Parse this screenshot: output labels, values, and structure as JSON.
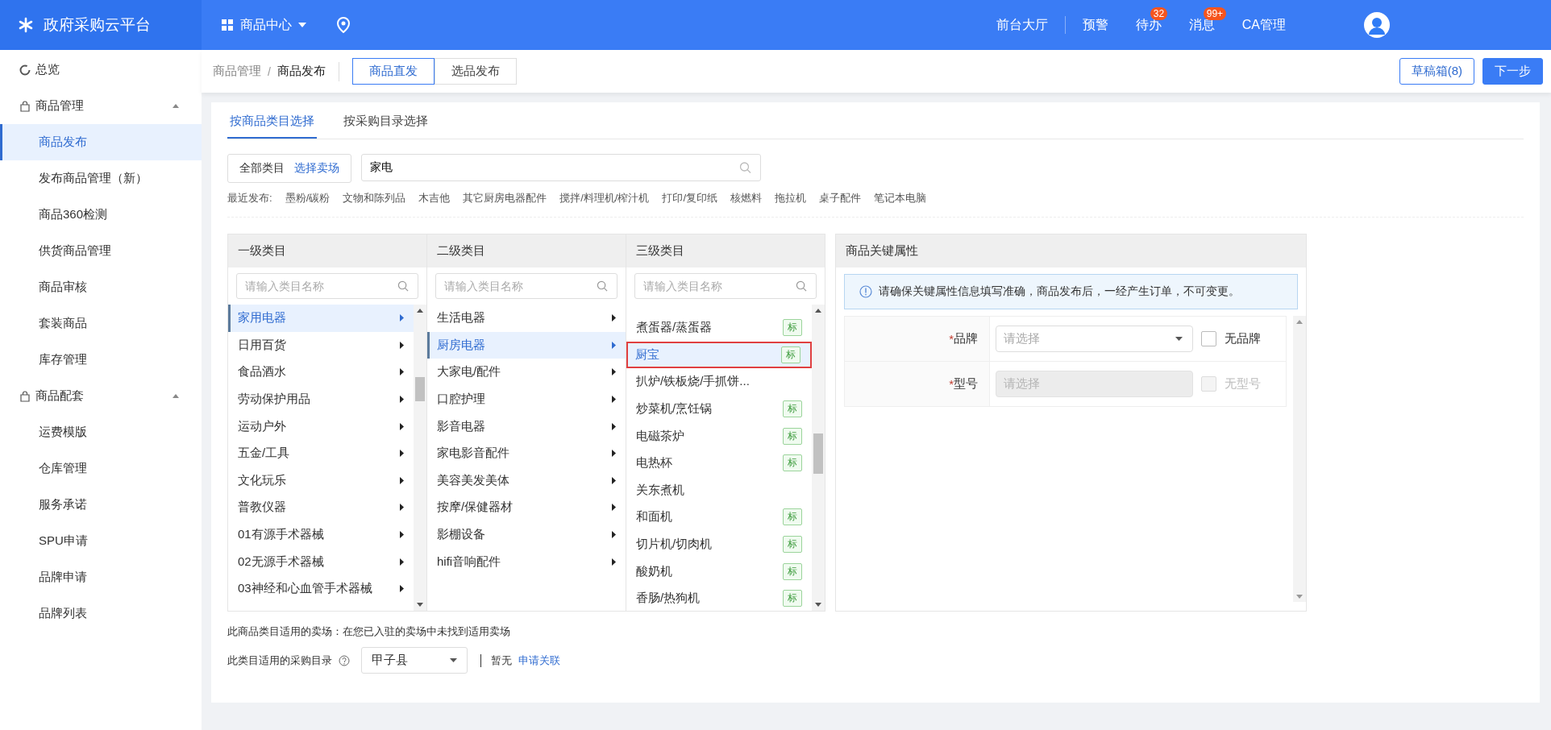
{
  "topbar": {
    "logo": "政府采购云平台",
    "nav_menu": "商品中心",
    "links": [
      {
        "label": "前台大厅"
      },
      {
        "label": "预警"
      },
      {
        "label": "待办",
        "badge": "32"
      },
      {
        "label": "消息",
        "badge": "99+"
      },
      {
        "label": "CA管理"
      }
    ]
  },
  "sidebar": {
    "items": [
      {
        "label": "总览",
        "kind": "link",
        "selected": false
      },
      {
        "label": "商品管理",
        "kind": "group",
        "expanded": true,
        "children": [
          {
            "label": "商品发布",
            "selected": true
          },
          {
            "label": "发布商品管理（新）",
            "selected": false
          },
          {
            "label": "商品360检测",
            "selected": false
          },
          {
            "label": "供货商品管理",
            "selected": false
          },
          {
            "label": "商品审核",
            "selected": false
          },
          {
            "label": "套装商品",
            "selected": false
          },
          {
            "label": "库存管理",
            "selected": false
          }
        ]
      },
      {
        "label": "商品配套",
        "kind": "group",
        "expanded": true,
        "children": [
          {
            "label": "运费模版",
            "selected": false
          },
          {
            "label": "仓库管理",
            "selected": false
          },
          {
            "label": "服务承诺",
            "selected": false
          },
          {
            "label": "SPU申请",
            "selected": false
          },
          {
            "label": "品牌申请",
            "selected": false
          },
          {
            "label": "品牌列表",
            "selected": false
          }
        ]
      }
    ]
  },
  "breadcrumb": {
    "items": [
      "商品管理",
      "商品发布"
    ],
    "separator": "/"
  },
  "mode_tabs": [
    {
      "label": "商品直发",
      "selected": true
    },
    {
      "label": "选品发布",
      "selected": false
    }
  ],
  "header_buttons": [
    {
      "label": "草稿箱(8)",
      "kind": "outline"
    },
    {
      "label": "下一步",
      "kind": "primary"
    }
  ],
  "category_tabs": [
    {
      "label": "按商品类目选择",
      "selected": true
    },
    {
      "label": "按采购目录选择",
      "selected": false
    }
  ],
  "scope": {
    "label": "全部类目",
    "link": "选择卖场"
  },
  "search": {
    "value": "家电"
  },
  "recent": {
    "label": "最近发布:",
    "items": [
      "墨粉/碳粉",
      "文物和陈列品",
      "木吉他",
      "其它厨房电器配件",
      "搅拌/料理机/榨汁机",
      "打印/复印纸",
      "核燃料",
      "拖拉机",
      "桌子配件",
      "笔记本电脑"
    ]
  },
  "columns": [
    {
      "title": "一级类目",
      "placeholder": "请输入类目名称",
      "items": [
        {
          "label": "家用电器",
          "selected": true,
          "has_children": true
        },
        {
          "label": "日用百货",
          "selected": false,
          "has_children": true
        },
        {
          "label": "食品酒水",
          "selected": false,
          "has_children": true
        },
        {
          "label": "劳动保护用品",
          "selected": false,
          "has_children": true
        },
        {
          "label": "运动户外",
          "selected": false,
          "has_children": true
        },
        {
          "label": "五金/工具",
          "selected": false,
          "has_children": true
        },
        {
          "label": "文化玩乐",
          "selected": false,
          "has_children": true
        },
        {
          "label": "普教仪器",
          "selected": false,
          "has_children": true
        },
        {
          "label": "01有源手术器械",
          "selected": false,
          "has_children": true
        },
        {
          "label": "02无源手术器械",
          "selected": false,
          "has_children": true
        },
        {
          "label": "03神经和心血管手术器械",
          "selected": false,
          "has_children": true
        }
      ]
    },
    {
      "title": "二级类目",
      "placeholder": "请输入类目名称",
      "items": [
        {
          "label": "生活电器",
          "selected": false,
          "has_children": true
        },
        {
          "label": "厨房电器",
          "selected": true,
          "has_children": true
        },
        {
          "label": "大家电/配件",
          "selected": false,
          "has_children": true
        },
        {
          "label": "口腔护理",
          "selected": false,
          "has_children": true
        },
        {
          "label": "影音电器",
          "selected": false,
          "has_children": true
        },
        {
          "label": "家电影音配件",
          "selected": false,
          "has_children": true
        },
        {
          "label": "美容美发美体",
          "selected": false,
          "has_children": true
        },
        {
          "label": "按摩/保健器材",
          "selected": false,
          "has_children": true
        },
        {
          "label": "影棚设备",
          "selected": false,
          "has_children": true
        },
        {
          "label": "hifi音响配件",
          "selected": false,
          "has_children": true
        }
      ]
    },
    {
      "title": "三级类目",
      "placeholder": "请输入类目名称",
      "items": [
        {
          "label": "煮蛋器/蒸蛋器",
          "selected": false,
          "has_children": false,
          "tag": "标"
        },
        {
          "label": "厨宝",
          "selected": true,
          "has_children": false,
          "tag": "标"
        },
        {
          "label": "扒炉/铁板烧/手抓饼...",
          "selected": false,
          "has_children": false
        },
        {
          "label": "炒菜机/烹饪锅",
          "selected": false,
          "has_children": false,
          "tag": "标"
        },
        {
          "label": "电磁茶炉",
          "selected": false,
          "has_children": false,
          "tag": "标"
        },
        {
          "label": "电热杯",
          "selected": false,
          "has_children": false,
          "tag": "标"
        },
        {
          "label": "关东煮机",
          "selected": false,
          "has_children": false
        },
        {
          "label": "和面机",
          "selected": false,
          "has_children": false,
          "tag": "标"
        },
        {
          "label": "切片机/切肉机",
          "selected": false,
          "has_children": false,
          "tag": "标"
        },
        {
          "label": "酸奶机",
          "selected": false,
          "has_children": false,
          "tag": "标"
        },
        {
          "label": "香肠/热狗机",
          "selected": false,
          "has_children": false,
          "tag": "标"
        }
      ]
    }
  ],
  "attributes": {
    "title": "商品关键属性",
    "notice": "请确保关键属性信息填写准确，商品发布后，一经产生订单，不可变更。",
    "fields": [
      {
        "label": "品牌",
        "required_mark": "*",
        "placeholder": "请选择",
        "disabled": false,
        "option": "无品牌",
        "checked": false
      },
      {
        "label": "型号",
        "required_mark": "*",
        "placeholder": "请选择",
        "disabled": true,
        "option": "无型号",
        "checked": false
      }
    ]
  },
  "footer": {
    "market_line": "此商品类目适用的卖场：在您已入驻的卖场中未找到适用卖场",
    "catalog_label": "此类目适用的采购目录",
    "catalog_value": "甲子县",
    "status": "暂无",
    "link": "申请关联"
  }
}
